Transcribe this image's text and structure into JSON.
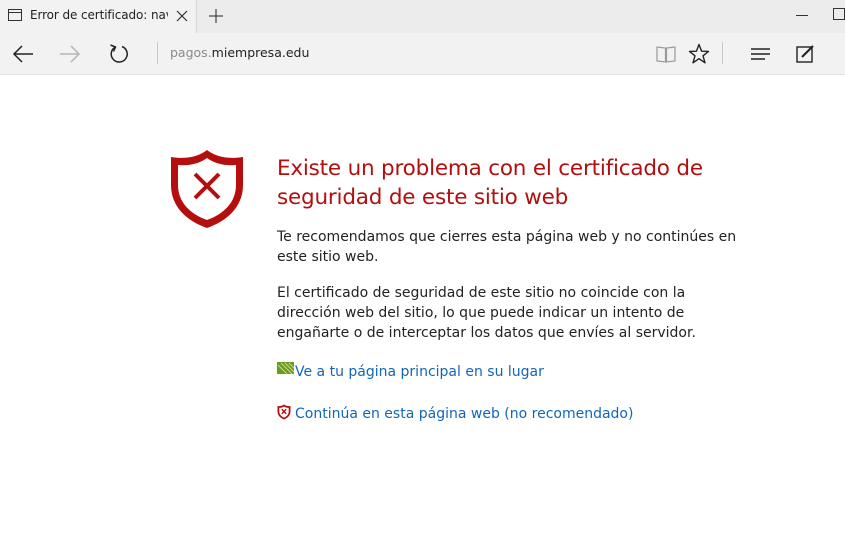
{
  "tab": {
    "title": "Error de certificado: nave",
    "icon": "page-icon"
  },
  "toolbar": {
    "back_icon": "back-arrow-icon",
    "forward_icon": "forward-arrow-icon",
    "refresh_icon": "refresh-icon",
    "reading_view_icon": "book-icon",
    "favorite_icon": "star-icon",
    "hub_icon": "hub-lines-icon",
    "notes_icon": "web-note-icon"
  },
  "address": {
    "prefix": "pagos.",
    "domain": "miempresa.edu"
  },
  "error": {
    "heading": "Existe un problema con el certificado de seguridad de este sitio web",
    "recommendation": "Te recomendamos que cierres esta página web y no continúes en este sitio web.",
    "detail": "El certificado de seguridad de este sitio no coincide con la dirección web del sitio, lo que puede indicar un intento de engañarte o de interceptar los datos que envíes al servidor."
  },
  "links": {
    "home": "Ve a tu página principal en su lugar",
    "continue": "Continúa en esta página web (no recomendado)"
  },
  "colors": {
    "heading": "#b40e0e",
    "link": "#1266b8",
    "shield": "#b40e0e",
    "home_icon": "#6a9a1f"
  }
}
